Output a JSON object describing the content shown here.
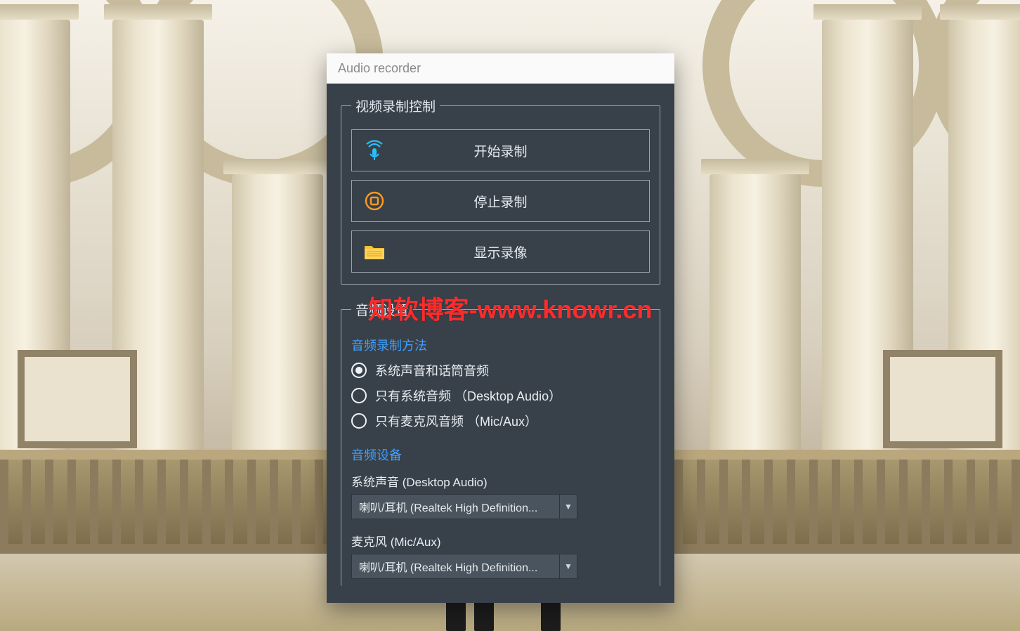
{
  "window": {
    "title": "Audio recorder"
  },
  "groups": {
    "video_control_legend": "视频录制控制",
    "audio_settings_legend": "音频设置"
  },
  "buttons": {
    "start_label": "开始录制",
    "stop_label": "停止录制",
    "show_label": "显示录像"
  },
  "audio_method": {
    "title": "音频录制方法",
    "options": [
      "系统声音和话筒音频",
      "只有系统音频  （Desktop Audio）",
      "只有麦克风音频  （Mic/Aux）"
    ],
    "selected_index": 0
  },
  "audio_device": {
    "title": "音频设备",
    "desktop": {
      "label": "系统声音 (Desktop Audio)",
      "value": "喇叭/耳机 (Realtek  High  Definition..."
    },
    "mic": {
      "label": "麦克风 (Mic/Aux)",
      "value": "喇叭/耳机 (Realtek  High  Definition..."
    }
  },
  "watermark": "知软博客-www.knowr.cn"
}
